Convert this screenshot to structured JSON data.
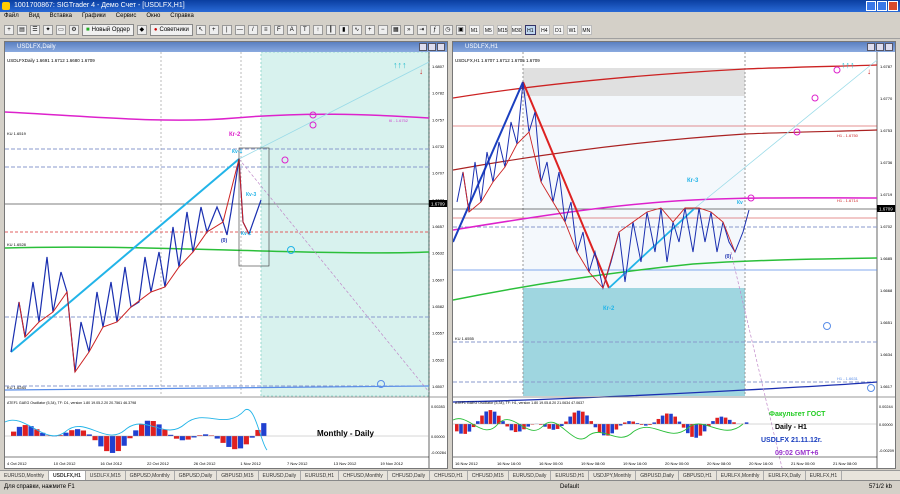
{
  "app": {
    "title": "1001700867: SIGTrader 4 - Демо Счет - [USDLFX,H1]"
  },
  "menu": [
    "Файл",
    "Вид",
    "Вставка",
    "Графики",
    "Сервис",
    "Окно",
    "Справка"
  ],
  "toolbar": {
    "new_order": "Новый Ордер",
    "advisors": "Советники",
    "timeframes": [
      "M1",
      "M5",
      "M15",
      "M30",
      "H1",
      "H4",
      "D1",
      "W1",
      "MN"
    ],
    "active_timeframe": "H1"
  },
  "left_chart": {
    "window_title": "USDLFX,Daily",
    "symbol_line": "USDLFXDaily  1.6691 1.6712 1.6680 1.6709",
    "labels": {
      "kr2": "Кr-2",
      "kv1": "Кv-1",
      "kv3": "Кv-3",
      "kv2": "Кv-2",
      "zero": "(0)",
      "hline1": "KU 1.6519",
      "hline2": "KU 1.6528",
      "hline3": "KU 1.6284",
      "cancel_h1": "Кl - 1.6752"
    },
    "prices": [
      "1.6807",
      "1.6782",
      "1.6757",
      "1.6732",
      "1.6707",
      "1.6682",
      "1.6657",
      "1.6632",
      "1.6607",
      "1.6582",
      "1.6557",
      "1.6532",
      "1.6507"
    ],
    "current_price": "1.6709",
    "dates": [
      "4 Oct 2012",
      "10 Oct 2012",
      "16 Oct 2012",
      "22 Oct 2012",
      "26 Oct 2012",
      "1 Nov 2012",
      "7 Nov 2012",
      "13 Nov 2012",
      "19 Nov 2012"
    ],
    "indicator_label": "ATEF1 GAEG Oscillator (5,34), TF: D1, version 1.80  19.05.2.20 20.7561 46.3798",
    "osc_prices": [
      "0.00283",
      "0.00000",
      "-0.00284"
    ],
    "caption": "Monthly - Daily"
  },
  "right_chart": {
    "window_title": "USDLFX,H1",
    "symbol_line": "USDLFX,H1  1.6707 1.6712 1.6705 1.6709",
    "labels": {
      "kr3": "Кr-3",
      "kr2": "Кr-2",
      "kv": "Кv",
      "zero": "(0)",
      "h1_level_a": "H1 - 1.6750",
      "h1_level_b": "H1 - 1.6714",
      "h1_level_c": "H1 - 1.6631",
      "ku": "KU 1.6555"
    },
    "prices": [
      "1.6787",
      "1.6770",
      "1.6753",
      "1.6736",
      "1.6719",
      "1.6702",
      "1.6685",
      "1.6668",
      "1.6651",
      "1.6634",
      "1.6617"
    ],
    "current_price": "1.6709",
    "dates": [
      "16 Nov 2012",
      "16 Nov 16:00",
      "16 Nov 00:00",
      "19 Nov 08:00",
      "19 Nov 16:00",
      "20 Nov 00:00",
      "20 Nov 08:00",
      "20 Nov 16:00",
      "21 Nov 00:00",
      "21 Nov 08:00"
    ],
    "indicator_label": "ATEF1 GAEG Oscillator (5,34), TF: H1, version 1.80  19.05.8.20 21.0634 47.0637",
    "osc_prices": [
      "0.00244",
      "0.00000",
      "-0.00209"
    ],
    "caption_lines": [
      "Факультет ГОСТ",
      "Daily - H1",
      "USDLFX 21.11.12г.",
      "09:02  GMT+6"
    ],
    "caption_colors": [
      "#22cc22",
      "#000000",
      "#1a3fbf",
      "#9933cc"
    ]
  },
  "tabs": [
    "EURUSD,Monthly",
    "USDLFX,H1",
    "USDLFX,M15",
    "GBPUSD,Monthly",
    "GBPUSD,Daily",
    "GBPUSD,M15",
    "EURUSD,Daily",
    "EURUSD,H1",
    "CHFUSD,Monthly",
    "CHFUSD,Daily",
    "CHFUSD,H1",
    "CHFUSD,M15",
    "EURUSD,Daily",
    "EURUSD,H1",
    "USDJPY,Monthly",
    "GBPUSD,Daily",
    "GBPUSD,H1",
    "EURLFX,Monthly",
    "EURLFX,Daily",
    "EURLFX,H1"
  ],
  "active_tab": "USDLFX,H1",
  "status": {
    "help": "Для справки, нажмите F1",
    "profile": "Default",
    "traffic": "571/2 kb"
  },
  "colors": {
    "title_blue": "#0a3ea0",
    "line_blue": "#1a2fb0",
    "line_red": "#cc2222",
    "trend_cyan": "#22b4e8",
    "magenta": "#dd22cc",
    "green": "#2bbf3a",
    "teal_zone": "#b9e8e0"
  }
}
